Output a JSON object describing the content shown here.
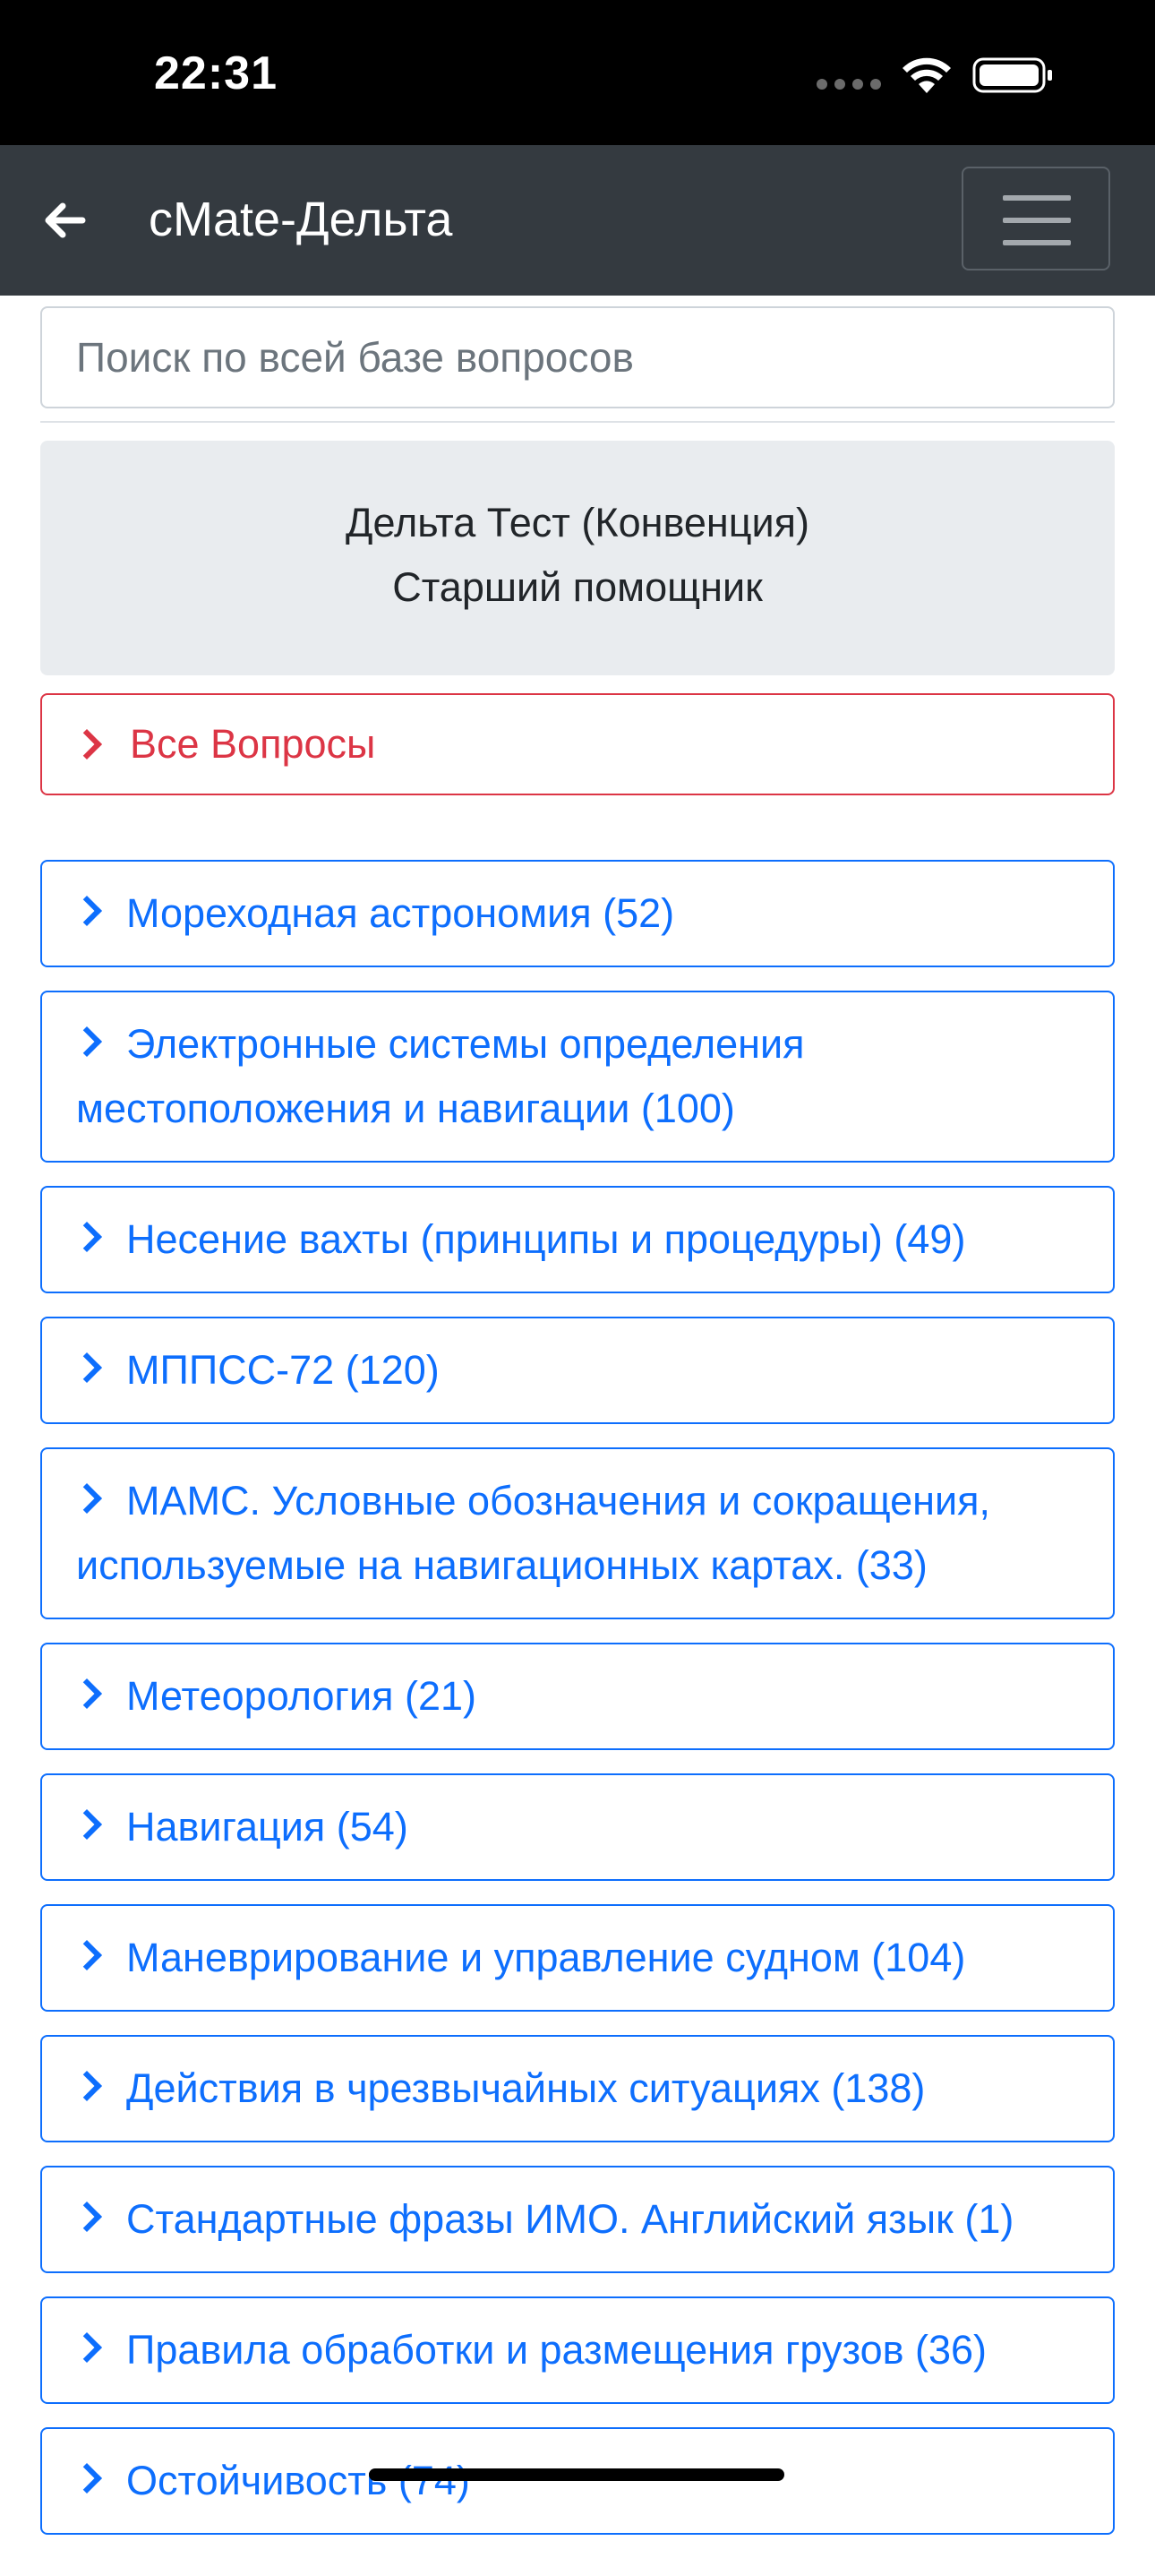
{
  "status_bar": {
    "time": "22:31"
  },
  "navbar": {
    "title": "cMate-Дельта",
    "back_icon": "arrow-left-icon",
    "menu_icon": "hamburger-icon"
  },
  "search": {
    "placeholder": "Поиск по всей базе вопросов",
    "value": ""
  },
  "info": {
    "line1": "Дельта Тест (Конвенция)",
    "line2": "Старший помощник"
  },
  "all_questions": {
    "label": "Все Вопросы",
    "color": "#dc3545"
  },
  "categories": [
    {
      "label": "Мореходная астрономия (52)"
    },
    {
      "label": "Электронные системы определения местоположения и навигации (100)"
    },
    {
      "label": "Несение вахты (принципы и процедуры) (49)"
    },
    {
      "label": "МППСС-72 (120)"
    },
    {
      "label": "МАМС. Условные обозначения и сокращения, используемые на навигационных картах. (33)"
    },
    {
      "label": "Метеорология (21)"
    },
    {
      "label": "Навигация (54)"
    },
    {
      "label": "Маневрирование и управление судном (104)"
    },
    {
      "label": "Действия в чрезвычайных ситуациях (138)"
    },
    {
      "label": "Стандартные фразы ИМО. Английский язык (1)"
    },
    {
      "label": "Правила обработки и размещения грузов (36)"
    },
    {
      "label": "Остойчивость (74)"
    }
  ],
  "colors": {
    "navbar_bg": "#343a40",
    "primary": "#0d6efd",
    "danger": "#dc3545"
  }
}
